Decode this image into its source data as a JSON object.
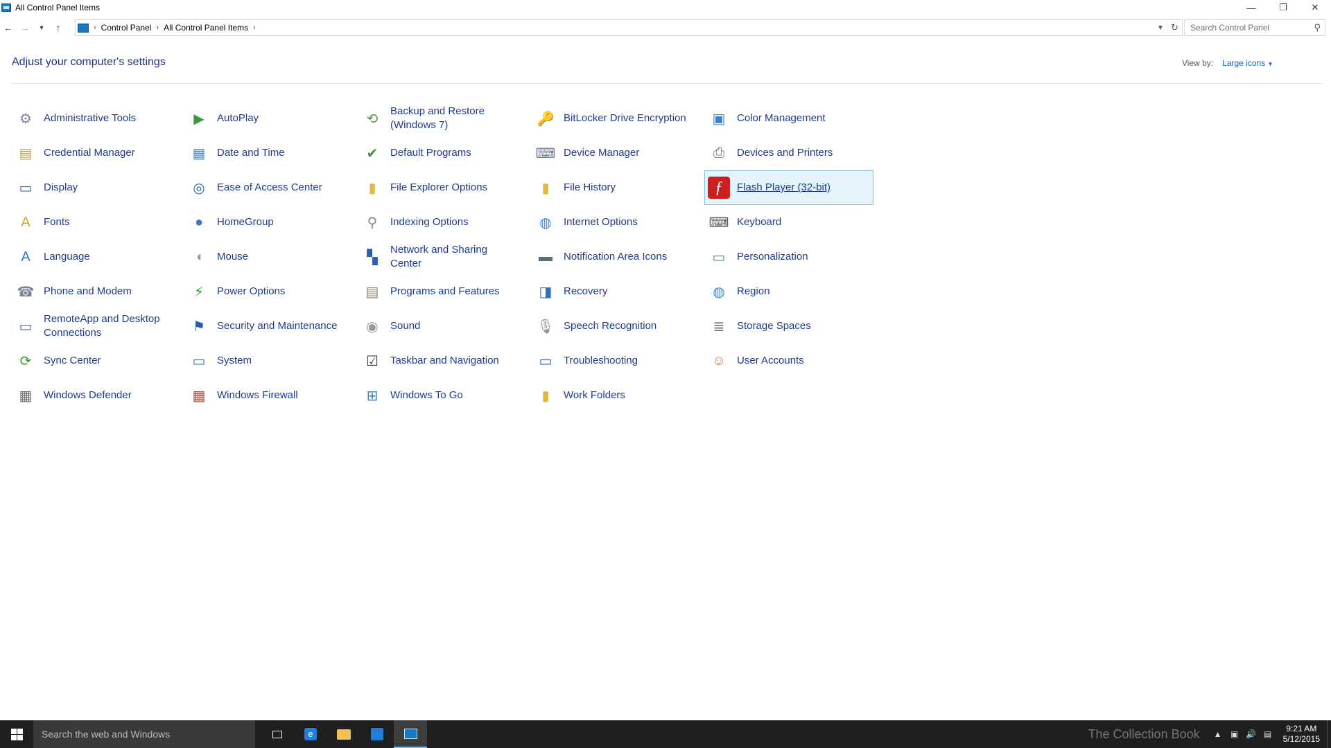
{
  "window": {
    "title": "All Control Panel Items",
    "minimize_icon": "minimize-icon",
    "maximize_icon": "restore-icon",
    "close_icon": "close-icon"
  },
  "address_bar": {
    "breadcrumbs": [
      "Control Panel",
      "All Control Panel Items"
    ],
    "search_placeholder": "Search Control Panel"
  },
  "header": {
    "title": "Adjust your computer's settings",
    "view_by_label": "View by:",
    "view_by_value": "Large icons"
  },
  "items": [
    {
      "label": "Administrative Tools",
      "icon": "administrative-tools-icon",
      "glyph": "⚙",
      "color": "#7a8aa0"
    },
    {
      "label": "AutoPlay",
      "icon": "autoplay-icon",
      "glyph": "▶",
      "color": "#3b9a3b"
    },
    {
      "label": "Backup and Restore (Windows 7)",
      "icon": "backup-restore-icon",
      "glyph": "⟲",
      "color": "#5a9a44"
    },
    {
      "label": "BitLocker Drive Encryption",
      "icon": "bitlocker-icon",
      "glyph": "🔑",
      "color": "#8a8a8a"
    },
    {
      "label": "Color Management",
      "icon": "color-management-icon",
      "glyph": "▣",
      "color": "#3c7fd1"
    },
    {
      "label": "Credential Manager",
      "icon": "credential-manager-icon",
      "glyph": "▤",
      "color": "#c6a24a"
    },
    {
      "label": "Date and Time",
      "icon": "date-time-icon",
      "glyph": "▦",
      "color": "#4f8fd6"
    },
    {
      "label": "Default Programs",
      "icon": "default-programs-icon",
      "glyph": "✔",
      "color": "#3e8e3e"
    },
    {
      "label": "Device Manager",
      "icon": "device-manager-icon",
      "glyph": "⌨",
      "color": "#6e7b89"
    },
    {
      "label": "Devices and Printers",
      "icon": "devices-printers-icon",
      "glyph": "⎙",
      "color": "#7a7a7a"
    },
    {
      "label": "Display",
      "icon": "display-icon",
      "glyph": "▭",
      "color": "#2a6fc9"
    },
    {
      "label": "Ease of Access Center",
      "icon": "ease-of-access-icon",
      "glyph": "◎",
      "color": "#2f64b8"
    },
    {
      "label": "File Explorer Options",
      "icon": "file-explorer-options-icon",
      "glyph": "▮",
      "color": "#e3b94a"
    },
    {
      "label": "File History",
      "icon": "file-history-icon",
      "glyph": "▮",
      "color": "#e0b544"
    },
    {
      "label": "Flash Player (32-bit)",
      "icon": "flash-player-icon",
      "glyph": "ƒ",
      "color": "#cc1f1f",
      "selected": true
    },
    {
      "label": "Fonts",
      "icon": "fonts-icon",
      "glyph": "A",
      "color": "#d4a63a"
    },
    {
      "label": "HomeGroup",
      "icon": "homegroup-icon",
      "glyph": "●",
      "color": "#3a78c4"
    },
    {
      "label": "Indexing Options",
      "icon": "indexing-options-icon",
      "glyph": "⚲",
      "color": "#8a8a8a"
    },
    {
      "label": "Internet Options",
      "icon": "internet-options-icon",
      "glyph": "◍",
      "color": "#3e8ad1"
    },
    {
      "label": "Keyboard",
      "icon": "keyboard-icon",
      "glyph": "⌨",
      "color": "#555555"
    },
    {
      "label": "Language",
      "icon": "language-icon",
      "glyph": "A",
      "color": "#2e7ac6"
    },
    {
      "label": "Mouse",
      "icon": "mouse-icon",
      "glyph": "◖",
      "color": "#9a9a9a"
    },
    {
      "label": "Network and Sharing Center",
      "icon": "network-sharing-icon",
      "glyph": "▚",
      "color": "#2a5fae"
    },
    {
      "label": "Notification Area Icons",
      "icon": "notification-area-icon",
      "glyph": "▬",
      "color": "#5a6b7c"
    },
    {
      "label": "Personalization",
      "icon": "personalization-icon",
      "glyph": "▭",
      "color": "#3d9a58"
    },
    {
      "label": "Phone and Modem",
      "icon": "phone-modem-icon",
      "glyph": "☎",
      "color": "#7a8594"
    },
    {
      "label": "Power Options",
      "icon": "power-options-icon",
      "glyph": "⚡",
      "color": "#3b9a3b"
    },
    {
      "label": "Programs and Features",
      "icon": "programs-features-icon",
      "glyph": "▤",
      "color": "#8c7b6a"
    },
    {
      "label": "Recovery",
      "icon": "recovery-icon",
      "glyph": "◨",
      "color": "#2f6fc2"
    },
    {
      "label": "Region",
      "icon": "region-icon",
      "glyph": "◍",
      "color": "#3e8ad1"
    },
    {
      "label": "RemoteApp and Desktop Connections",
      "icon": "remoteapp-icon",
      "glyph": "▭",
      "color": "#3a6fb8"
    },
    {
      "label": "Security and Maintenance",
      "icon": "security-maintenance-icon",
      "glyph": "⚑",
      "color": "#2e5aa8"
    },
    {
      "label": "Sound",
      "icon": "sound-icon",
      "glyph": "◉",
      "color": "#9a9a9a"
    },
    {
      "label": "Speech Recognition",
      "icon": "speech-recognition-icon",
      "glyph": "🎙",
      "color": "#8a8a8a"
    },
    {
      "label": "Storage Spaces",
      "icon": "storage-spaces-icon",
      "glyph": "≣",
      "color": "#6f6f6f"
    },
    {
      "label": "Sync Center",
      "icon": "sync-center-icon",
      "glyph": "⟳",
      "color": "#2f9a2f"
    },
    {
      "label": "System",
      "icon": "system-icon",
      "glyph": "▭",
      "color": "#2a6fc9"
    },
    {
      "label": "Taskbar and Navigation",
      "icon": "taskbar-navigation-icon",
      "glyph": "☑",
      "color": "#3c3c3c"
    },
    {
      "label": "Troubleshooting",
      "icon": "troubleshooting-icon",
      "glyph": "▭",
      "color": "#2a5fae"
    },
    {
      "label": "User Accounts",
      "icon": "user-accounts-icon",
      "glyph": "☺",
      "color": "#c08a4a"
    },
    {
      "label": "Windows Defender",
      "icon": "windows-defender-icon",
      "glyph": "▦",
      "color": "#6a6a6a"
    },
    {
      "label": "Windows Firewall",
      "icon": "windows-firewall-icon",
      "glyph": "▦",
      "color": "#b0462f"
    },
    {
      "label": "Windows To Go",
      "icon": "windows-to-go-icon",
      "glyph": "⊞",
      "color": "#2f8ad8"
    },
    {
      "label": "Work Folders",
      "icon": "work-folders-icon",
      "glyph": "▮",
      "color": "#e0b544"
    }
  ],
  "taskbar": {
    "search_placeholder": "Search the web and Windows",
    "watermark": "The Collection Book",
    "time": "9:21 AM",
    "date": "5/12/2015"
  }
}
